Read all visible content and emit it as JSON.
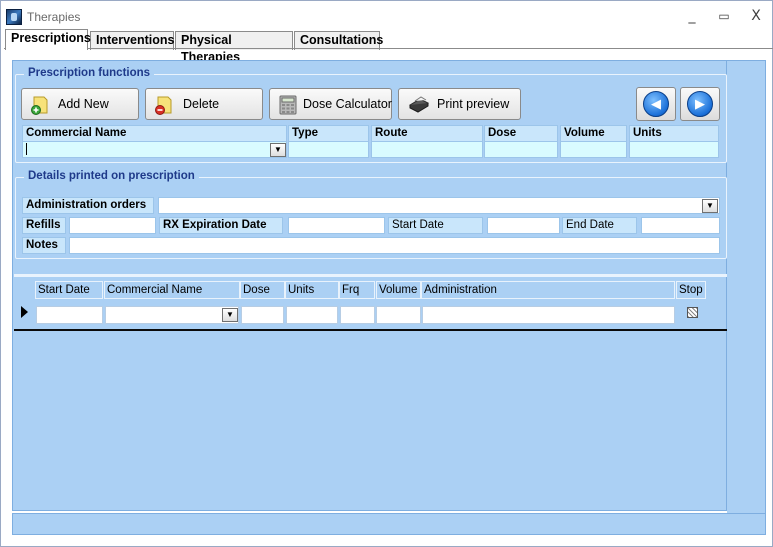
{
  "window": {
    "title": "Therapies",
    "controls": [
      "_",
      "▭",
      "X"
    ]
  },
  "tabs": [
    "Prescriptions",
    "Interventions",
    "Physical Therapies",
    "Consultations"
  ],
  "prescription_functions": {
    "legend": "Prescription functions",
    "buttons": {
      "add_new": "Add New",
      "delete": "Delete",
      "dose_calculator": "Dose Calculator",
      "print_preview": "Print preview"
    },
    "columns": [
      "Commercial Name",
      "Type",
      "Route",
      "Dose",
      "Volume",
      "Units"
    ]
  },
  "details": {
    "legend": "Details printed on prescription",
    "labels": {
      "administration_orders": "Administration orders",
      "refills": "Refills",
      "rx_expiration_date": "RX Expiration Date",
      "start_date": "Start Date",
      "end_date": "End Date",
      "notes": "Notes"
    }
  },
  "grid": {
    "columns": [
      "Start Date",
      "Commercial Name",
      "Dose",
      "Units",
      "Frq",
      "Volume",
      "Administration",
      "Stop"
    ]
  },
  "colors": {
    "panel": "#abd0f4",
    "legend_text": "#1f3a8a",
    "field_cyan": "#d9fbff"
  }
}
